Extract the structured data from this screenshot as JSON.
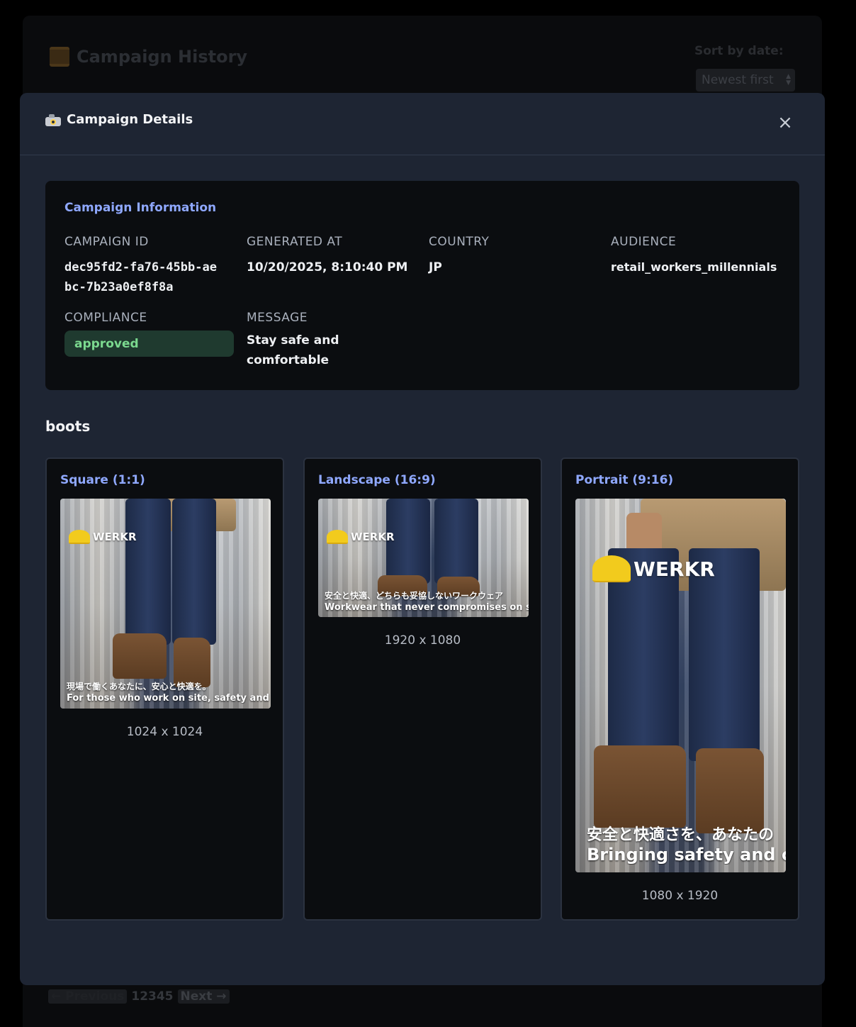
{
  "background": {
    "title": "Campaign History",
    "sort_label": "Sort by date:",
    "sort_value": "Newest first",
    "pager": {
      "prev": "← Previous",
      "pages": "12345",
      "next": "Next →"
    }
  },
  "modal": {
    "title": "Campaign Details",
    "close_label": "×",
    "info": {
      "heading": "Campaign Information",
      "campaign_id_label": "CAMPAIGN ID",
      "campaign_id": "dec95fd2-fa76-45bb-aebc-7b23a0ef8f8a",
      "generated_at_label": "GENERATED AT",
      "generated_at": "10/20/2025, 8:10:40 PM",
      "country_label": "COUNTRY",
      "country": "JP",
      "audience_label": "AUDIENCE",
      "audience": "retail_workers_millennials",
      "compliance_label": "COMPLIANCE",
      "compliance": "approved",
      "message_label": "MESSAGE",
      "message": "Stay safe and comfortable"
    },
    "product": "boots",
    "assets": [
      {
        "title": "Square (1:1)",
        "dims": "1024 x 1024",
        "logo": "WERKR",
        "line_jp": "現場で働くあなたに、安心と快適を。",
        "line_en": "For those who work on site, safety and cor"
      },
      {
        "title": "Landscape (16:9)",
        "dims": "1920 x 1080",
        "logo": "WERKR",
        "line_jp": "安全と快適、どちらも妥協しないワークウェア",
        "line_en": "Workwear that never compromises on safe"
      },
      {
        "title": "Portrait (9:16)",
        "dims": "1080 x 1920",
        "logo": "WERKR",
        "line_jp": "安全と快適さを、あなたの",
        "line_en": "Bringing safety and cor"
      }
    ]
  },
  "colors": {
    "modal_bg": "#1e2533",
    "card_bg": "#0b0d10",
    "accent": "#8fa8ff",
    "badge_bg": "#1f3a2f",
    "badge_text": "#7bd98f"
  }
}
